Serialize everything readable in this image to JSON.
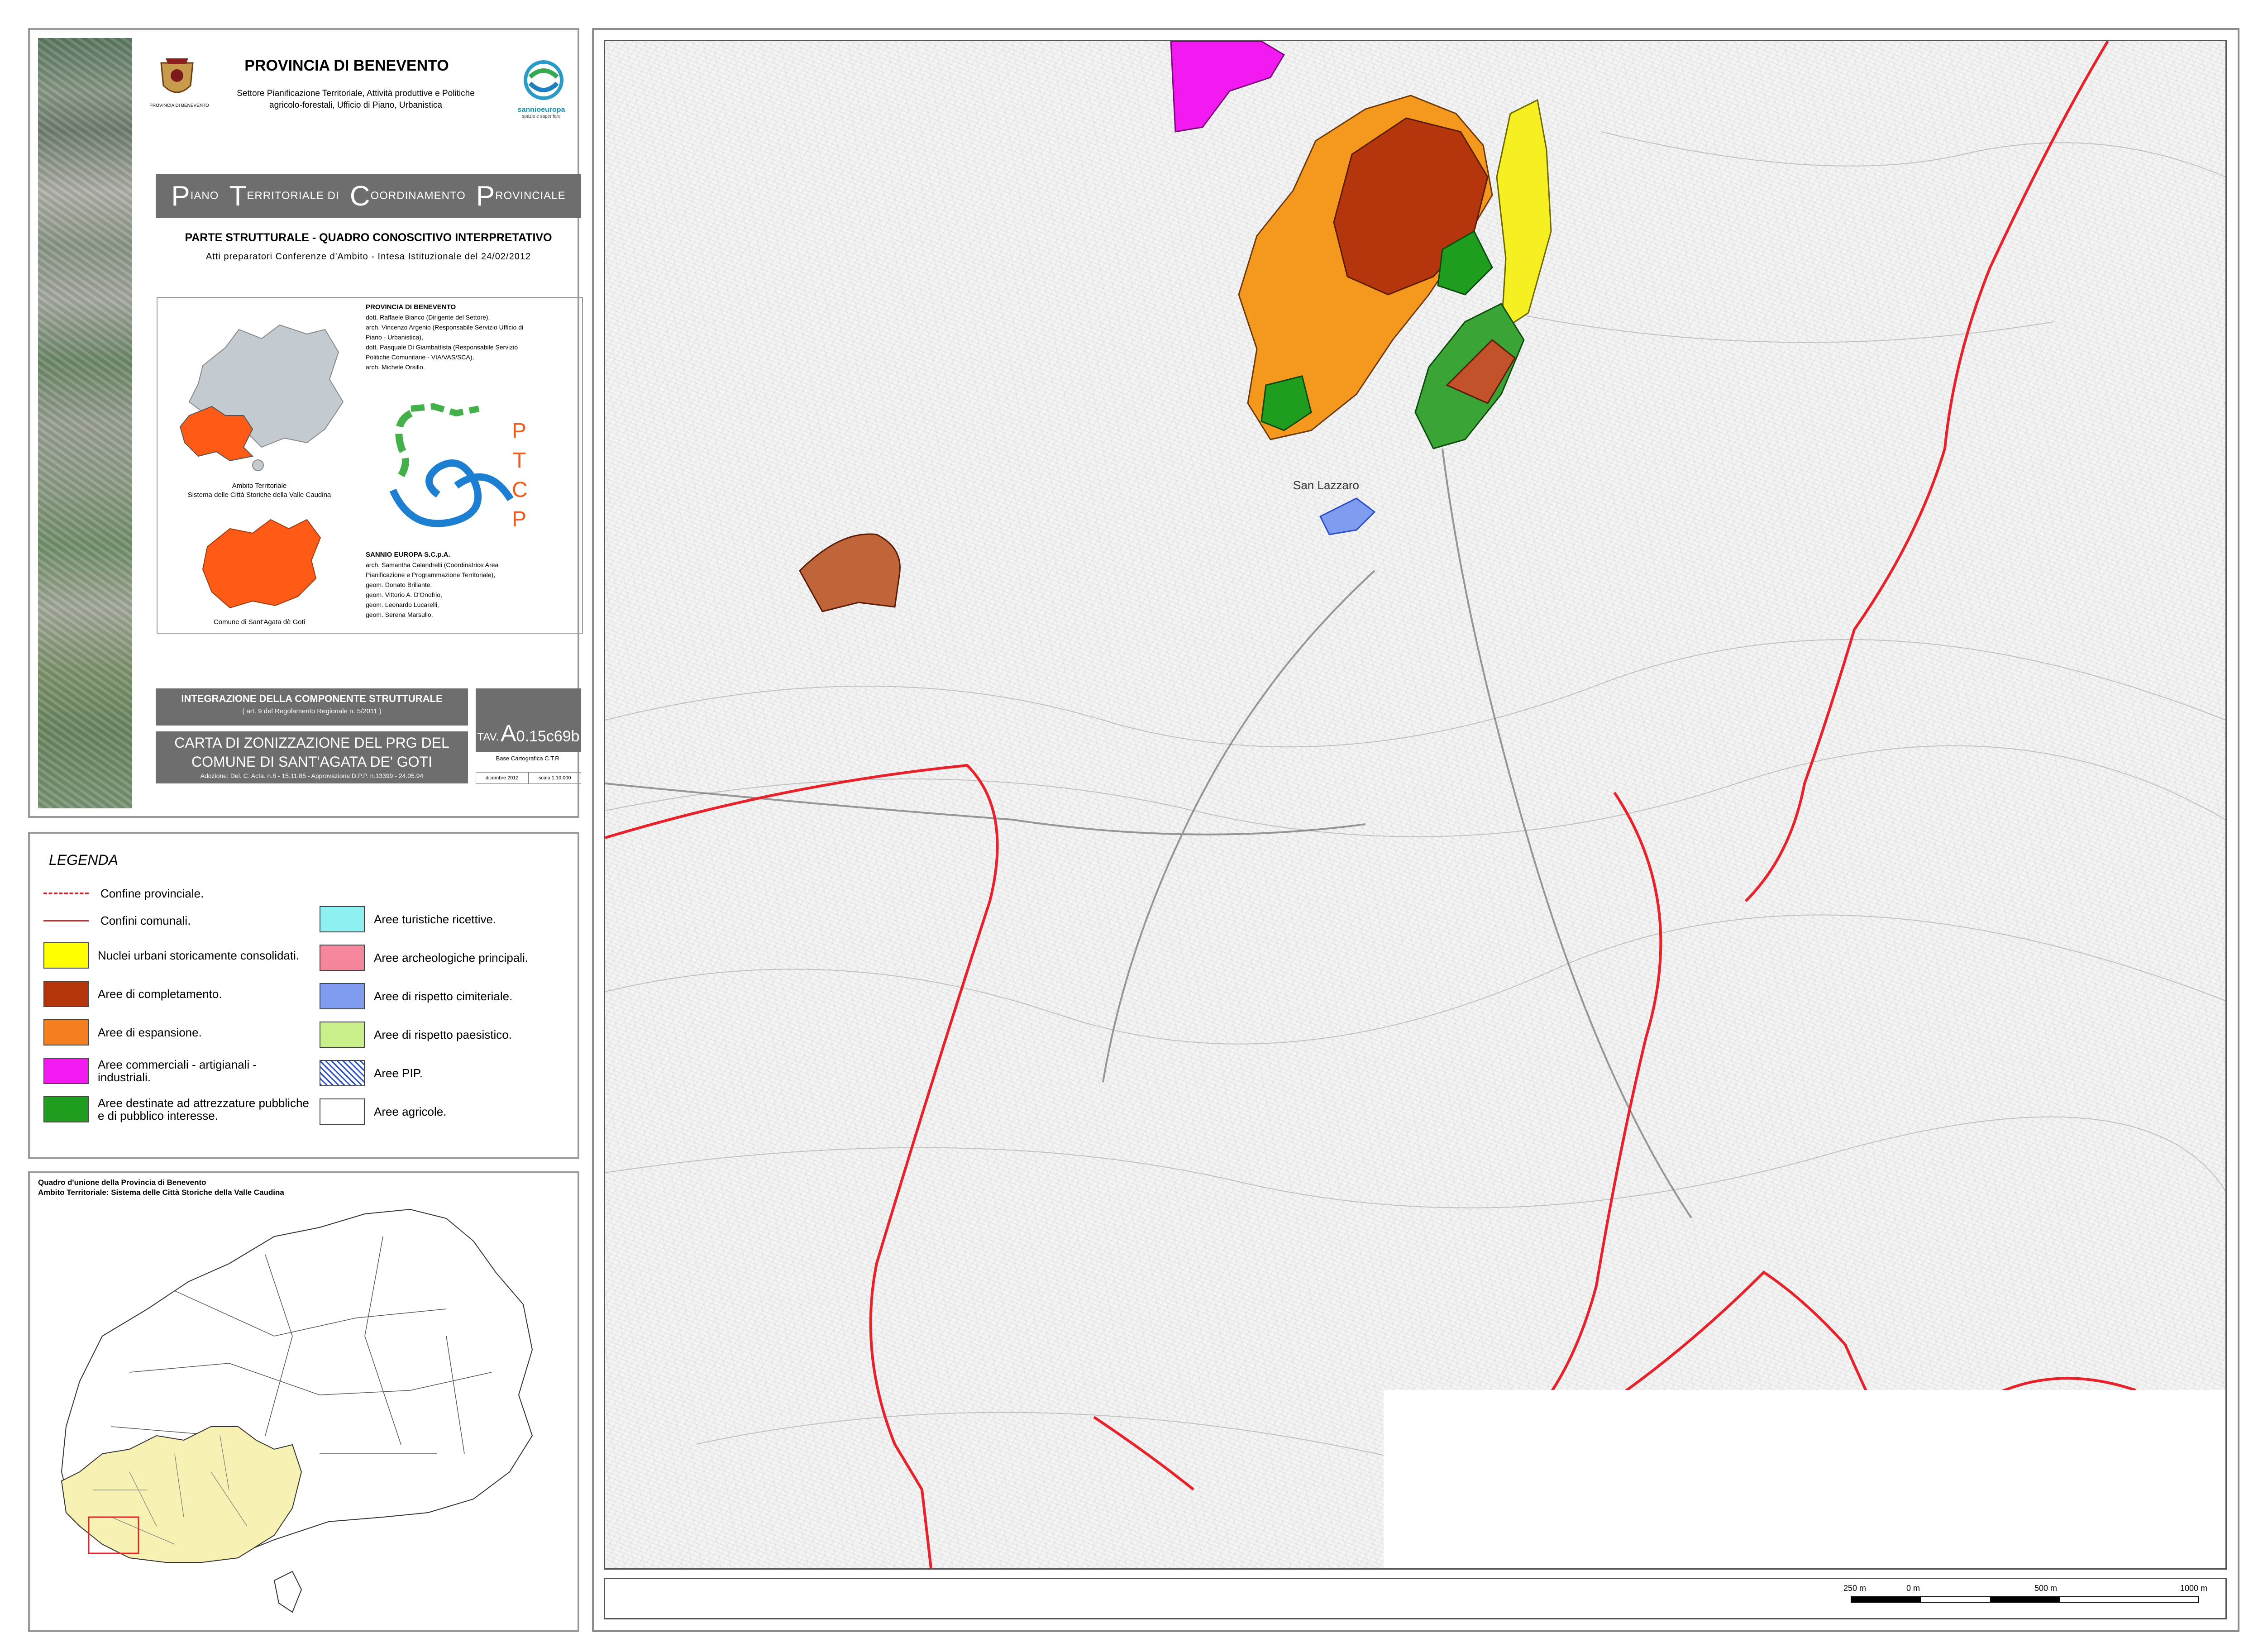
{
  "header": {
    "province_title": "PROVINCIA DI BENEVENTO",
    "coat_caption": "PROVINCIA DI BENEVENTO",
    "department_line1": "Settore Pianificazione Territoriale, Attività produttive e Politiche",
    "department_line2": "agricolo-forestali, Ufficio di Piano, Urbanistica",
    "partner_logo_text": "sannioeuropa",
    "partner_tagline": "spazio e saper fare"
  },
  "plan": {
    "p1": "P",
    "w1": "IANO",
    "p2": "T",
    "w2": "ERRITORIALE DI",
    "p3": "C",
    "w3": "OORDINAMENTO",
    "p4": "P",
    "w4": "ROVINCIALE",
    "section_title": "PARTE STRUTTURALE - QUADRO CONOSCITIVO INTERPRETATIVO",
    "section_subtitle": "Atti preparatori Conferenze d'Ambito - Intesa Istituzionale del 24/02/2012"
  },
  "credits": {
    "heading": "PROVINCIA DI BENEVENTO",
    "line1": "dott. Raffaele Bianco (Dirigente del Settore),",
    "line2": "arch. Vincenzo Argenio (Responsabile Servizio Ufficio di",
    "line3": "Piano - Urbanistica),",
    "line4": "dott. Pasquale Di Giambattista (Responsabile Servizio",
    "line5": "Politiche Comunitarie - VIA/VAS/SCA),",
    "line6": "arch. Michele Orsillo.",
    "heading2": "SANNIO EUROPA S.C.p.A.",
    "l2_1": "arch. Samantha Calandrelli (Coordinatrice Area",
    "l2_2": "Pianificazione e Programmazione Territoriale),",
    "l2_3": "geom. Donato Brillante,",
    "l2_4": "geom. Vittorio A. D'Onofrio,",
    "l2_5": "geom. Leonardo Lucarelli,",
    "l2_6": "geom. Serena Marsullo."
  },
  "captions": {
    "ambito_line1": "Ambito Territoriale",
    "ambito_line2": "Sistema delle Città Storiche della Valle Caudina",
    "comune": "Comune di Sant'Agata dè Goti"
  },
  "ptcp_logo": {
    "p": "P",
    "t": "T",
    "c": "C",
    "p2": "P"
  },
  "integration": {
    "line1": "INTEGRAZIONE DELLA COMPONENTE STRUTTURALE",
    "line2": "( art. 9 del Regolamento Regionale n. 5/2011 )"
  },
  "carta": {
    "line1": "CARTA DI ZONIZZAZIONE DEL PRG DEL",
    "line2": "COMUNE DI SANT'AGATA DE' GOTI",
    "line3": "Adozione: Del. C. Acta. n.8 - 15.11.85 - Approvazione:D.P.P. n.13399 - 24.05.94"
  },
  "tav": {
    "prefix": "TAV.",
    "big": "A",
    "rest": "0.15c69b",
    "base": "Base Cartografica C.T.R.",
    "date": "dicembre 2012",
    "scale": "scala 1:10.000"
  },
  "legend": {
    "title": "LEGENDA",
    "items": [
      {
        "label": "Confine provinciale."
      },
      {
        "label": "Confini comunali."
      },
      {
        "label": "Nuclei urbani storicamente consolidati.",
        "color": "#ffff00"
      },
      {
        "label": "Aree di completamento.",
        "color": "#b5360d"
      },
      {
        "label": "Aree di espansione.",
        "color": "#f57f1e"
      },
      {
        "label": "Aree commerciali - artigianali - industriali.",
        "color": "#f21af0"
      },
      {
        "label": "Aree destinate ad attrezzature pubbliche e di pubblico interesse.",
        "color": "#1f9d1f"
      },
      {
        "label": "Aree turistiche ricettive.",
        "color": "#8ff0f2"
      },
      {
        "label": "Aree archeologiche principali.",
        "color": "#f5879d"
      },
      {
        "label": "Aree di rispetto cimiteriale.",
        "color": "#7f9cf0"
      },
      {
        "label": "Aree di rispetto paesistico.",
        "color": "#c9f08a"
      },
      {
        "label": "Aree PIP.",
        "color": "#ffffff"
      },
      {
        "label": "Aree agricole.",
        "color": "#ffffff"
      }
    ]
  },
  "inset": {
    "title1": "Quadro d'unione della Provincia di Benevento",
    "title2": "Ambito Territoriale: Sistema delle Città Storiche della Valle Caudina"
  },
  "map": {
    "place_label": "San Lazzaro"
  },
  "scale_bar": {
    "l0": "250 m",
    "l1": "0 m",
    "l2": "500 m",
    "l3": "1000 m"
  },
  "colors": {
    "completamento": "#b5360d",
    "espansione": "#f57f1e",
    "storico": "#ffff00",
    "commerciale": "#f21af0",
    "attrezzature": "#1f9d1f",
    "cimiteriale": "#7f9cf0",
    "confine": "#e8222b",
    "provincia_grey": "#c3cbd1",
    "ambito_orange": "#ff5a16",
    "inset_fill": "#f7f2b4"
  }
}
